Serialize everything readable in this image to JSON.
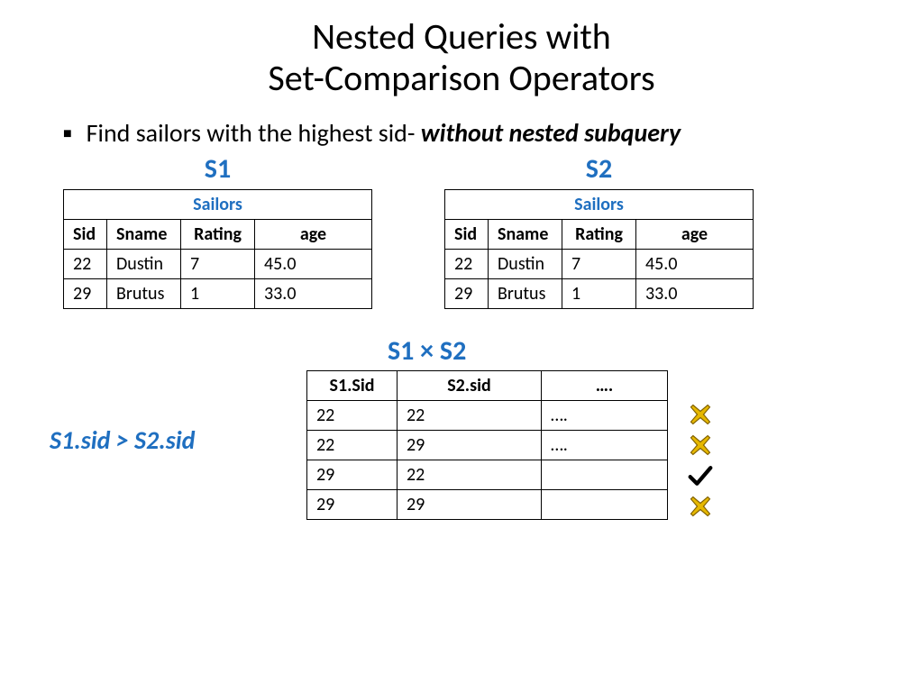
{
  "title_line1": "Nested Queries with",
  "title_line2": "Set-Comparison Operators",
  "bullet_prefix": "Find sailors with the highest sid- ",
  "bullet_bold": "without nested subquery",
  "s1": {
    "label": "S1",
    "caption": "Sailors",
    "headers": [
      "Sid",
      "Sname",
      "Rating",
      "age"
    ],
    "rows": [
      [
        "22",
        "Dustin",
        "7",
        "45.0"
      ],
      [
        "29",
        "Brutus",
        "1",
        "33.0"
      ]
    ]
  },
  "s2": {
    "label": "S2",
    "caption": "Sailors",
    "headers": [
      "Sid",
      "Sname",
      "Rating",
      "age"
    ],
    "rows": [
      [
        "22",
        "Dustin",
        "7",
        "45.0"
      ],
      [
        "29",
        "Brutus",
        "1",
        "33.0"
      ]
    ]
  },
  "product": {
    "label": "S1 × S2",
    "headers": [
      "S1.Sid",
      "S2.sid",
      "…."
    ],
    "rows": [
      [
        "22",
        "22",
        "…."
      ],
      [
        "22",
        "29",
        "…."
      ],
      [
        "29",
        "22",
        ""
      ],
      [
        "29",
        "29",
        ""
      ]
    ]
  },
  "condition": "S1.sid > S2.sid",
  "marks": [
    "cross",
    "cross",
    "check",
    "cross"
  ]
}
